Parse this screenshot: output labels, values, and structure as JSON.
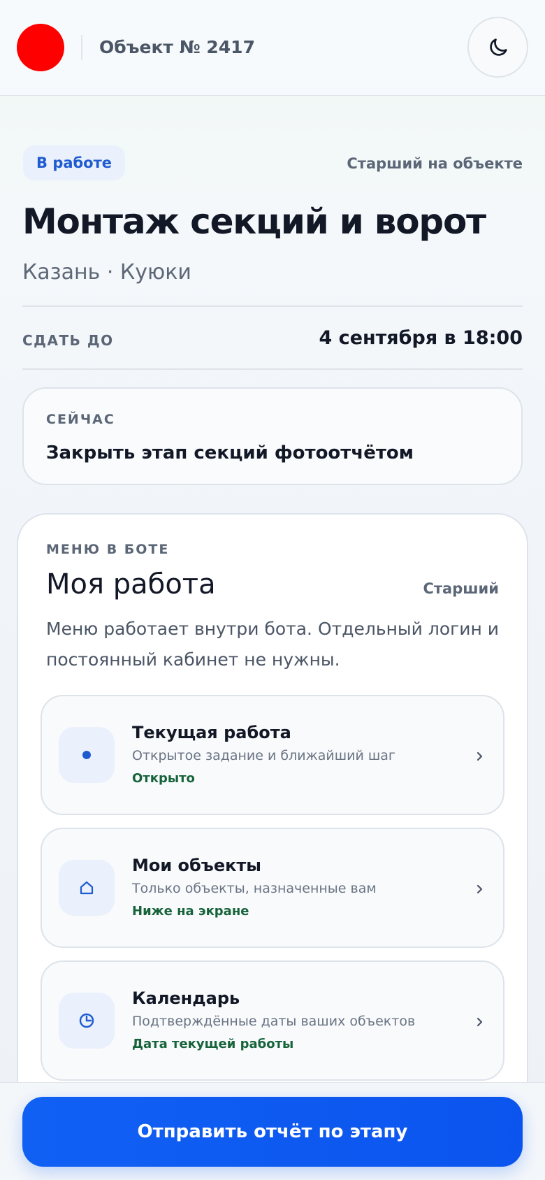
{
  "header": {
    "object_title": "Объект № 2417",
    "logo_color": "#ff0000",
    "theme_toggle_icon": "moon-icon"
  },
  "job": {
    "status": "В работе",
    "role": "Старший на объекте",
    "title": "Монтаж секций и ворот",
    "location": "Казань · Куюки",
    "deadline_label": "СДАТЬ ДО",
    "deadline_value": "4 сентября в 18:00"
  },
  "now": {
    "label": "СЕЙЧАС",
    "text": "Закрыть этап секций фотоотчётом"
  },
  "menu": {
    "label": "МЕНЮ В БОТЕ",
    "title": "Моя работа",
    "role": "Старший",
    "description": "Меню работает внутри бота. Отдельный логин и постоянный кабинет не нужны.",
    "items": [
      {
        "title": "Текущая работа",
        "subtitle": "Открытое задание и ближайший шаг",
        "status": "Открыто",
        "icon": "dot-icon"
      },
      {
        "title": "Мои объекты",
        "subtitle": "Только объекты, назначенные вам",
        "status": "Ниже на экране",
        "icon": "house-icon"
      },
      {
        "title": "Календарь",
        "subtitle": "Подтверждённые даты ваших объектов",
        "status": "Дата текущей работы",
        "icon": "clock-icon"
      }
    ]
  },
  "footer": {
    "submit_label": "Отправить отчёт по этапу"
  },
  "colors": {
    "accent": "#1160f4",
    "status_badge_text": "#1f5bd0",
    "status_green": "#16633a"
  }
}
